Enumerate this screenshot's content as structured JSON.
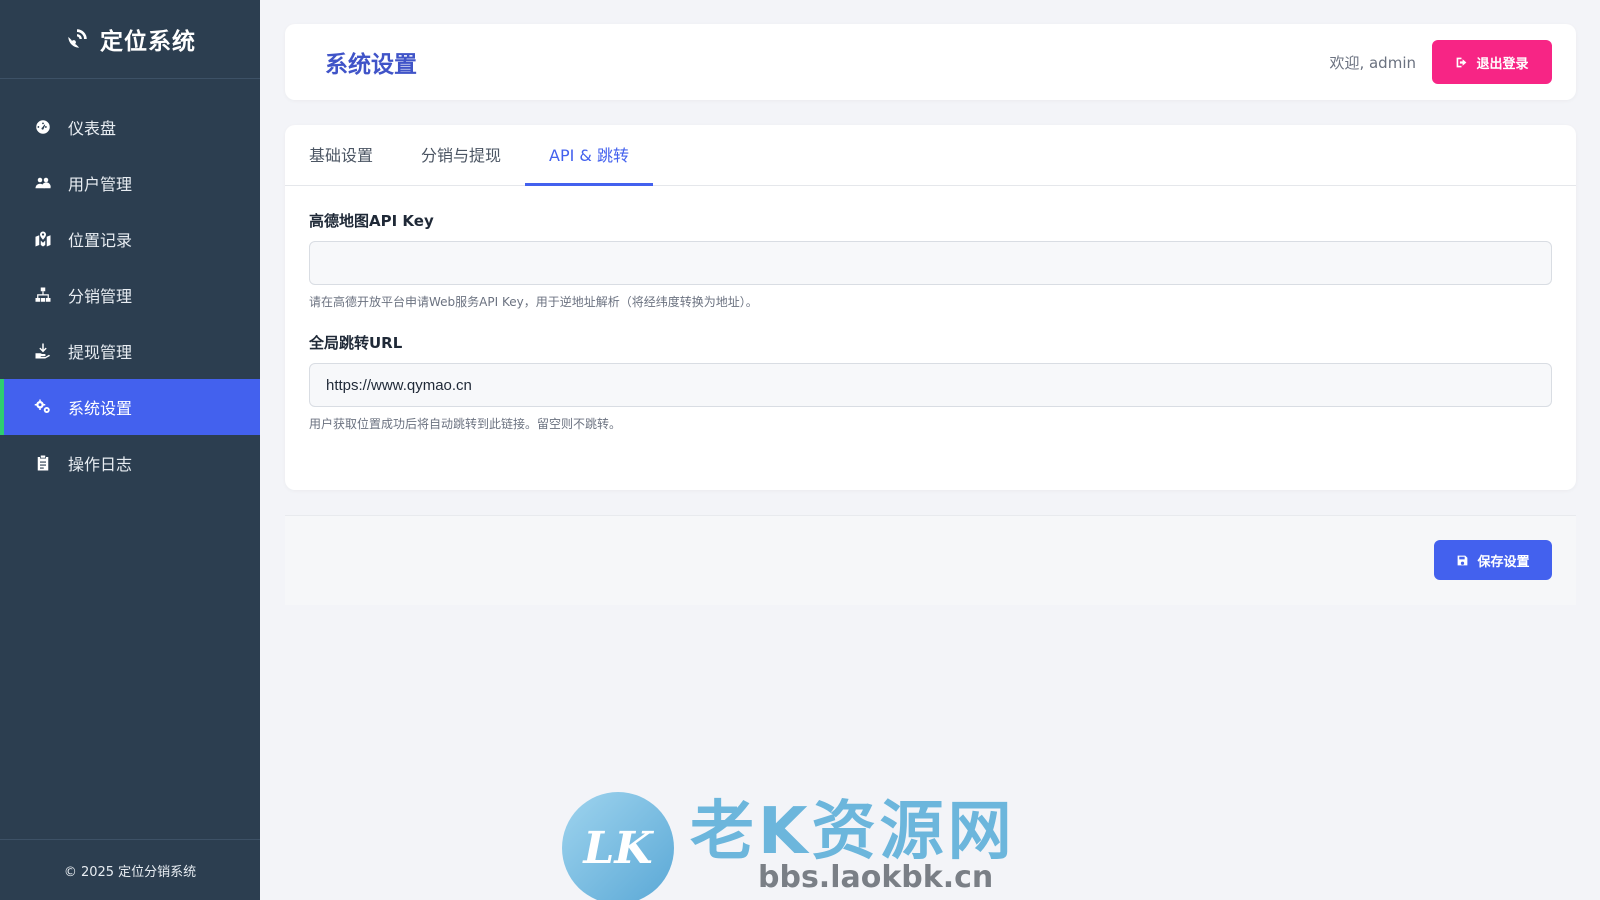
{
  "sidebar": {
    "brand": "定位系统",
    "brand_icon": "satellite-dish-icon",
    "items": [
      {
        "label": "仪表盘",
        "icon": "dashboard-icon",
        "active": false
      },
      {
        "label": "用户管理",
        "icon": "users-icon",
        "active": false
      },
      {
        "label": "位置记录",
        "icon": "map-marked-icon",
        "active": false
      },
      {
        "label": "分销管理",
        "icon": "sitemap-icon",
        "active": false
      },
      {
        "label": "提现管理",
        "icon": "hand-holding-money-icon",
        "active": false
      },
      {
        "label": "系统设置",
        "icon": "cogs-icon",
        "active": true
      },
      {
        "label": "操作日志",
        "icon": "clipboard-icon",
        "active": false
      }
    ],
    "footer": "© 2025 定位分销系统"
  },
  "header": {
    "title": "系统设置",
    "welcome": "欢迎, admin",
    "logout_label": "退出登录"
  },
  "tabs": [
    {
      "label": "基础设置",
      "active": false
    },
    {
      "label": "分销与提现",
      "active": false
    },
    {
      "label": "API & 跳转",
      "active": true
    }
  ],
  "form": {
    "amap_key": {
      "label": "高德地图API Key",
      "value": "",
      "help": "请在高德开放平台申请Web服务API Key，用于逆地址解析（将经纬度转换为地址）。"
    },
    "redirect_url": {
      "label": "全局跳转URL",
      "value": "https://www.qymao.cn",
      "help": "用户获取位置成功后将自动跳转到此链接。留空则不跳转。"
    }
  },
  "save_label": "保存设置",
  "watermark": {
    "badge": "LK",
    "title": "老K资源网",
    "url": "bbs.laokbk.cn"
  },
  "colors": {
    "sidebar_bg": "#2c3e50",
    "accent": "#4361ee",
    "active_indicator": "#2ecc71",
    "logout": "#f72585",
    "title": "#4054c8"
  }
}
